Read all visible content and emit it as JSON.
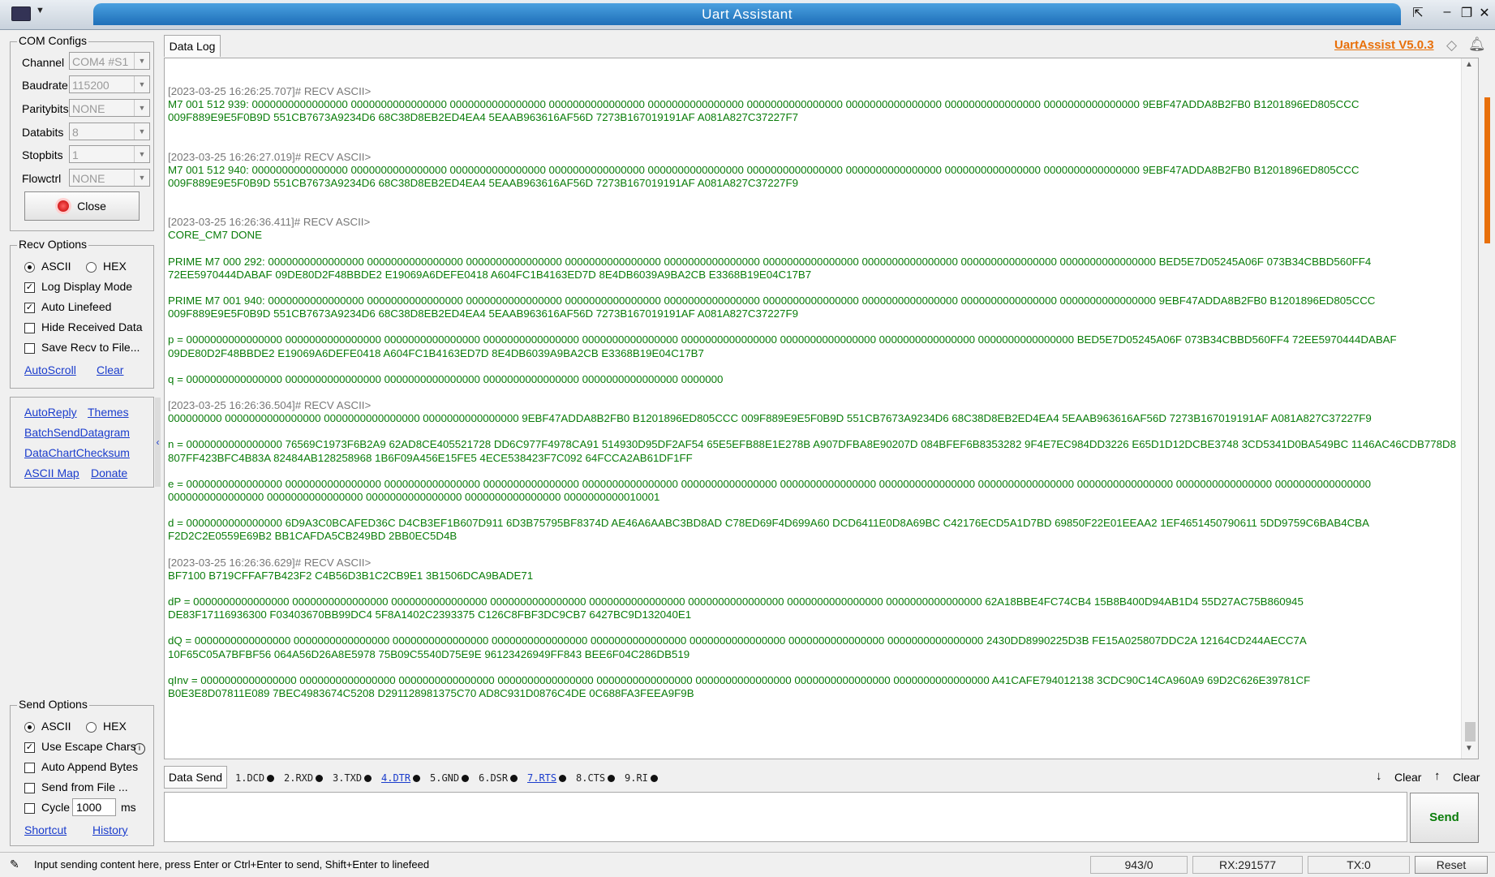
{
  "window": {
    "title": "Uart Assistant"
  },
  "com_configs": {
    "title": "COM Configs",
    "rows": [
      {
        "label": "Channel",
        "value": "COM4 #S1"
      },
      {
        "label": "Baudrate",
        "value": "115200"
      },
      {
        "label": "Paritybits",
        "value": "NONE"
      },
      {
        "label": "Databits",
        "value": "8"
      },
      {
        "label": "Stopbits",
        "value": "1"
      },
      {
        "label": "Flowctrl",
        "value": "NONE"
      }
    ],
    "close_label": "Close"
  },
  "recv_options": {
    "title": "Recv Options",
    "ascii": "ASCII",
    "hex": "HEX",
    "log_display": "Log Display Mode",
    "auto_linefeed": "Auto Linefeed",
    "hide_received": "Hide Received Data",
    "save_recv": "Save Recv to File...",
    "autoscroll": "AutoScroll",
    "clear": "Clear"
  },
  "tools": {
    "autoreply": "AutoReply",
    "themes": "Themes",
    "batchsend": "BatchSendDatagram",
    "datachart": "DataChartChecksum",
    "asciimap": "ASCII Map",
    "donate": "Donate"
  },
  "send_options": {
    "title": "Send Options",
    "ascii": "ASCII",
    "hex": "HEX",
    "escape": "Use Escape Chars",
    "append": "Auto Append Bytes",
    "from_file": "Send from File ...",
    "cycle": "Cycle",
    "cycle_value": "1000",
    "cycle_unit": "ms",
    "shortcut": "Shortcut",
    "history": "History"
  },
  "log": {
    "tab": "Data Log",
    "version": "UartAssist V5.0.3",
    "blocks": [
      {
        "ts": "[2023-03-25 16:26:25.707]# RECV ASCII>",
        "lines": [
          "M7 001 512 939: 0000000000000000 0000000000000000 0000000000000000 0000000000000000 0000000000000000 0000000000000000 0000000000000000 0000000000000000 0000000000000000 9EBF47ADDA8B2FB0 B1201896ED805CCC",
          "009F889E9E5F0B9D 551CB7673A9234D6 68C38D8EB2ED4EA4 5EAAB963616AF56D 7273B167019191AF A081A827C37227F7"
        ]
      },
      {
        "ts": "",
        "lines": []
      },
      {
        "ts": "[2023-03-25 16:26:27.019]# RECV ASCII>",
        "lines": [
          "M7 001 512 940: 0000000000000000 0000000000000000 0000000000000000 0000000000000000 0000000000000000 0000000000000000 0000000000000000 0000000000000000 0000000000000000 9EBF47ADDA8B2FB0 B1201896ED805CCC",
          "009F889E9E5F0B9D 551CB7673A9234D6 68C38D8EB2ED4EA4 5EAAB963616AF56D 7273B167019191AF A081A827C37227F9"
        ]
      },
      {
        "ts": "",
        "lines": []
      },
      {
        "ts": "[2023-03-25 16:26:36.411]# RECV ASCII>",
        "lines": [
          "CORE_CM7 DONE"
        ]
      },
      {
        "ts": "",
        "lines": [
          "PRIME M7 000 292: 0000000000000000 0000000000000000 0000000000000000 0000000000000000 0000000000000000 0000000000000000 0000000000000000 0000000000000000 0000000000000000 BED5E7D05245A06F 073B34CBBD560FF4",
          "72EE5970444DABAF 09DE80D2F48BBDE2 E19069A6DEFE0418 A604FC1B4163ED7D 8E4DB6039A9BA2CB E3368B19E04C17B7"
        ]
      },
      {
        "ts": "",
        "lines": [
          "PRIME M7 001 940: 0000000000000000 0000000000000000 0000000000000000 0000000000000000 0000000000000000 0000000000000000 0000000000000000 0000000000000000 0000000000000000 9EBF47ADDA8B2FB0 B1201896ED805CCC",
          "009F889E9E5F0B9D 551CB7673A9234D6 68C38D8EB2ED4EA4 5EAAB963616AF56D 7273B167019191AF A081A827C37227F9"
        ]
      },
      {
        "ts": "",
        "lines": [
          "p = 0000000000000000 0000000000000000 0000000000000000 0000000000000000 0000000000000000 0000000000000000 0000000000000000 0000000000000000 0000000000000000 BED5E7D05245A06F 073B34CBBD560FF4 72EE5970444DABAF",
          "09DE80D2F48BBDE2 E19069A6DEFE0418 A604FC1B4163ED7D 8E4DB6039A9BA2CB E3368B19E04C17B7"
        ]
      },
      {
        "ts": "",
        "lines": [
          "q = 0000000000000000 0000000000000000 0000000000000000 0000000000000000 0000000000000000 0000000"
        ]
      },
      {
        "ts": "[2023-03-25 16:26:36.504]# RECV ASCII>",
        "lines": [
          "000000000 0000000000000000 0000000000000000 0000000000000000 9EBF47ADDA8B2FB0 B1201896ED805CCC 009F889E9E5F0B9D 551CB7673A9234D6 68C38D8EB2ED4EA4 5EAAB963616AF56D 7273B167019191AF A081A827C37227F9"
        ]
      },
      {
        "ts": "",
        "lines": [
          "n = 0000000000000000 76569C1973F6B2A9 62AD8CE405521728 DD6C977F4978CA91 514930D95DF2AF54 65E5EFB88E1E278B A907DFBA8E90207D 084BFEF6B8353282 9F4E7EC984DD3226 E65D1D12DCBE3748 3CD5341D0BA549BC 1146AC46CDB778D8",
          "807FF423BFC4B83A 82484AB128258968 1B6F09A456E15FE5 4ECE538423F7C092 64FCCA2AB61DF1FF"
        ]
      },
      {
        "ts": "",
        "lines": [
          "e = 0000000000000000 0000000000000000 0000000000000000 0000000000000000 0000000000000000 0000000000000000 0000000000000000 0000000000000000 0000000000000000 0000000000000000 0000000000000000 0000000000000000",
          "0000000000000000 0000000000000000 0000000000000000 0000000000000000 0000000000010001"
        ]
      },
      {
        "ts": "",
        "lines": [
          "d = 0000000000000000 6D9A3C0BCAFED36C D4CB3EF1B607D911 6D3B75795BF8374D AE46A6AABC3BD8AD C78ED69F4D699A60 DCD6411E0D8A69BC C42176ECD5A1D7BD 69850F22E01EEAA2 1EF4651450790611 5DD9759C6BAB4CBA",
          "F2D2C2E0559E69B2 BB1CAFDA5CB249BD 2BB0EC5D4B"
        ]
      },
      {
        "ts": "[2023-03-25 16:26:36.629]# RECV ASCII>",
        "lines": [
          "BF7100 B719CFFAF7B423F2 C4B56D3B1C2CB9E1 3B1506DCA9BADE71"
        ]
      },
      {
        "ts": "",
        "lines": [
          "dP = 0000000000000000 0000000000000000 0000000000000000 0000000000000000 0000000000000000 0000000000000000 0000000000000000 0000000000000000 62A18BBE4FC74CB4 15B8B400D94AB1D4 55D27AC75B860945",
          "DE83F17116936300 F03403670BB99DC4 5F8A1402C2393375 C126C8FBF3DC9CB7 6427BC9D132040E1"
        ]
      },
      {
        "ts": "",
        "lines": [
          "dQ = 0000000000000000 0000000000000000 0000000000000000 0000000000000000 0000000000000000 0000000000000000 0000000000000000 0000000000000000 2430DD8990225D3B FE15A025807DDC2A 12164CD244AECC7A",
          "10F65C05A7BFBF56 064A56D26A8E5978 75B09C5540D75E9E 96123426949FF843 BEE6F04C286DB519"
        ]
      },
      {
        "ts": "",
        "lines": [
          "qInv = 0000000000000000 0000000000000000 0000000000000000 0000000000000000 0000000000000000 0000000000000000 0000000000000000 0000000000000000 A41CAFE794012138 3CDC90C14CA960A9 69D2C626E39781CF",
          "B0E3E8D07811E089 7BEC4983674C5208 D291128981375C70 AD8C931D0876C4DE 0C688FA3FEEA9F9B"
        ]
      }
    ]
  },
  "send": {
    "tab": "Data Send",
    "pins": [
      {
        "label": "1.DCD",
        "active": false
      },
      {
        "label": "2.RXD",
        "active": false
      },
      {
        "label": "3.TXD",
        "active": false
      },
      {
        "label": "4.DTR",
        "active": true
      },
      {
        "label": "5.GND",
        "active": false
      },
      {
        "label": "6.DSR",
        "active": false
      },
      {
        "label": "7.RTS",
        "active": true
      },
      {
        "label": "8.CTS",
        "active": false
      },
      {
        "label": "9.RI",
        "active": false
      }
    ],
    "clear_left": "Clear",
    "clear_right": "Clear",
    "send_label": "Send"
  },
  "status": {
    "hint": "Input sending content here, press Enter or Ctrl+Enter to send, Shift+Enter to linefeed",
    "count": "943/0",
    "rx": "RX:291577",
    "tx": "TX:0",
    "reset": "Reset"
  }
}
